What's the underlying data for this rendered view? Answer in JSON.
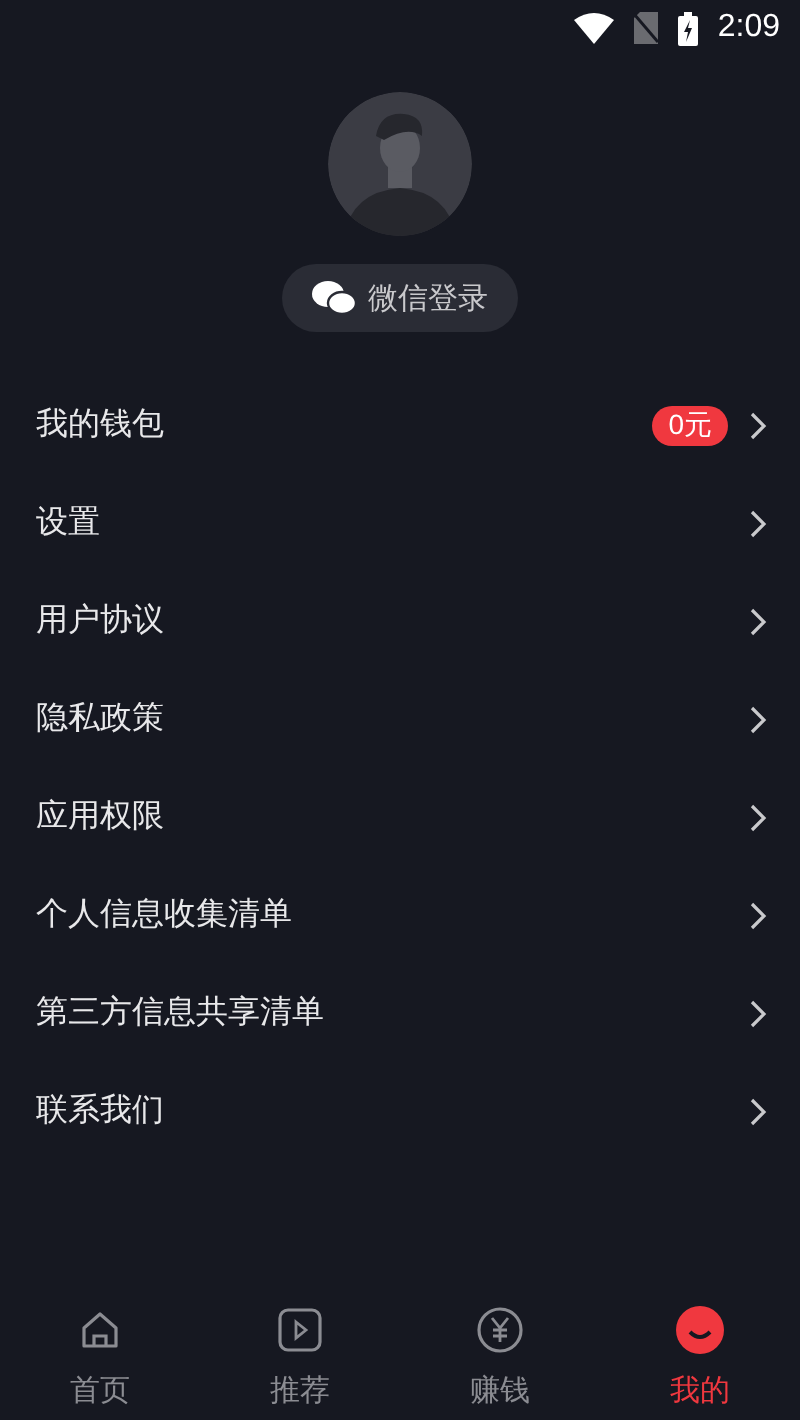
{
  "status_bar": {
    "time": "2:09"
  },
  "profile": {
    "login_button": "微信登录"
  },
  "menu": [
    {
      "label": "我的钱包",
      "badge": "0元"
    },
    {
      "label": "设置"
    },
    {
      "label": "用户协议"
    },
    {
      "label": "隐私政策"
    },
    {
      "label": "应用权限"
    },
    {
      "label": "个人信息收集清单"
    },
    {
      "label": "第三方信息共享清单"
    },
    {
      "label": "联系我们"
    }
  ],
  "tabs": [
    {
      "kind": "home",
      "label": "首页",
      "selected": false
    },
    {
      "kind": "play",
      "label": "推荐",
      "selected": false
    },
    {
      "kind": "yuan",
      "label": "赚钱",
      "selected": false
    },
    {
      "kind": "smile",
      "label": "我的",
      "selected": true
    }
  ]
}
